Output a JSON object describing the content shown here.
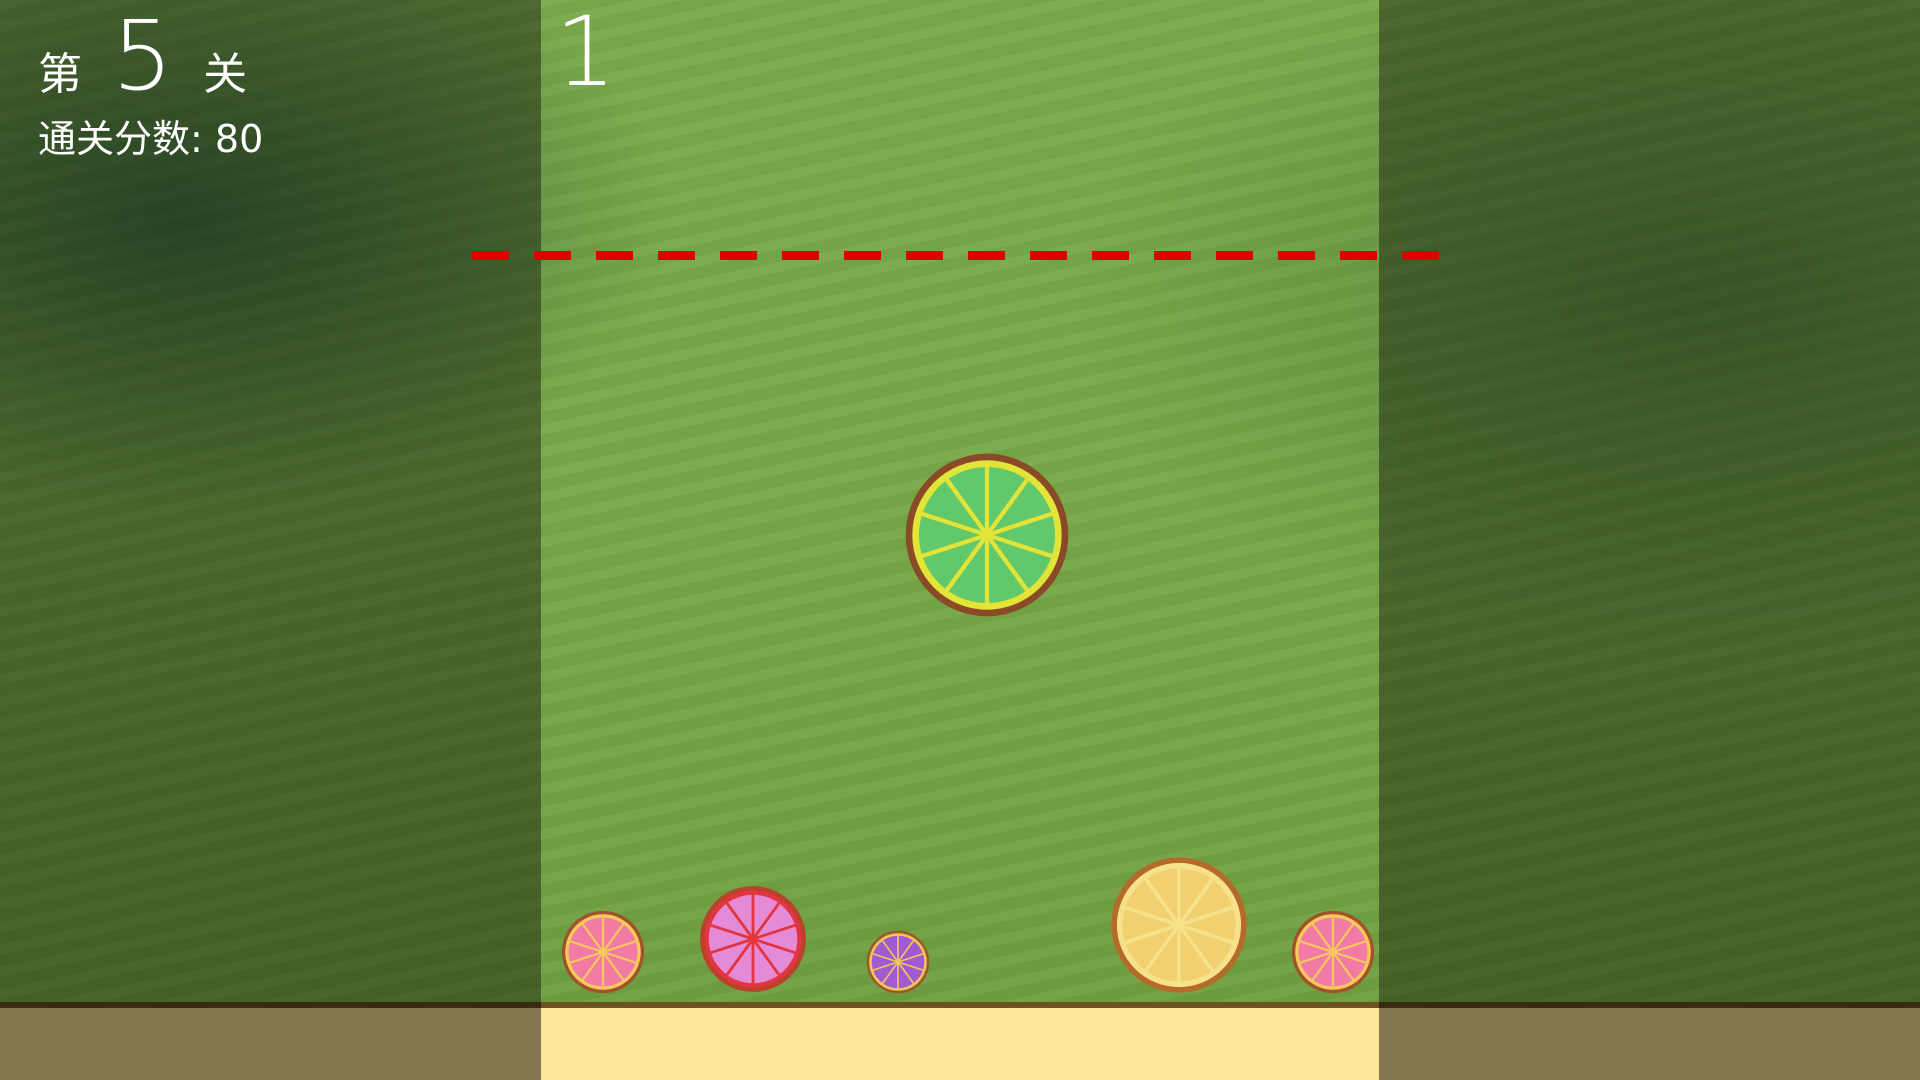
{
  "hud": {
    "level_prefix": "第",
    "level_number": "5",
    "level_suffix": "关",
    "target_score_label": "通关分数:",
    "target_score_value": "80",
    "current_score": "1"
  },
  "colors": {
    "danger_line": "#e00000",
    "ground": "#fde59a",
    "ground_border": "#6f5224"
  },
  "fruits": [
    {
      "name": "lime",
      "icon": "lime-slice-icon",
      "rind": "#8a4a28",
      "flesh": "#62c86c",
      "pith": "#e2e437"
    },
    {
      "name": "grapefruit-small-left",
      "icon": "grapefruit-slice-icon",
      "rind": "#a0522d",
      "flesh": "#f27ba6",
      "pith": "#f8c95a"
    },
    {
      "name": "pink-citrus",
      "icon": "pink-citrus-slice-icon",
      "rind": "#b8432a",
      "flesh": "#e58ad6",
      "pith": "#e2353f"
    },
    {
      "name": "plum",
      "icon": "plum-slice-icon",
      "rind": "#9a5a2a",
      "flesh": "#a05bd0",
      "pith": "#f2c55a"
    },
    {
      "name": "lemon",
      "icon": "lemon-slice-icon",
      "rind": "#b56a2a",
      "flesh": "#f2d070",
      "pith": "#f6e28a"
    },
    {
      "name": "grapefruit-small-right",
      "icon": "grapefruit-slice-icon",
      "rind": "#a0522d",
      "flesh": "#f27ba6",
      "pith": "#f8c95a"
    }
  ]
}
